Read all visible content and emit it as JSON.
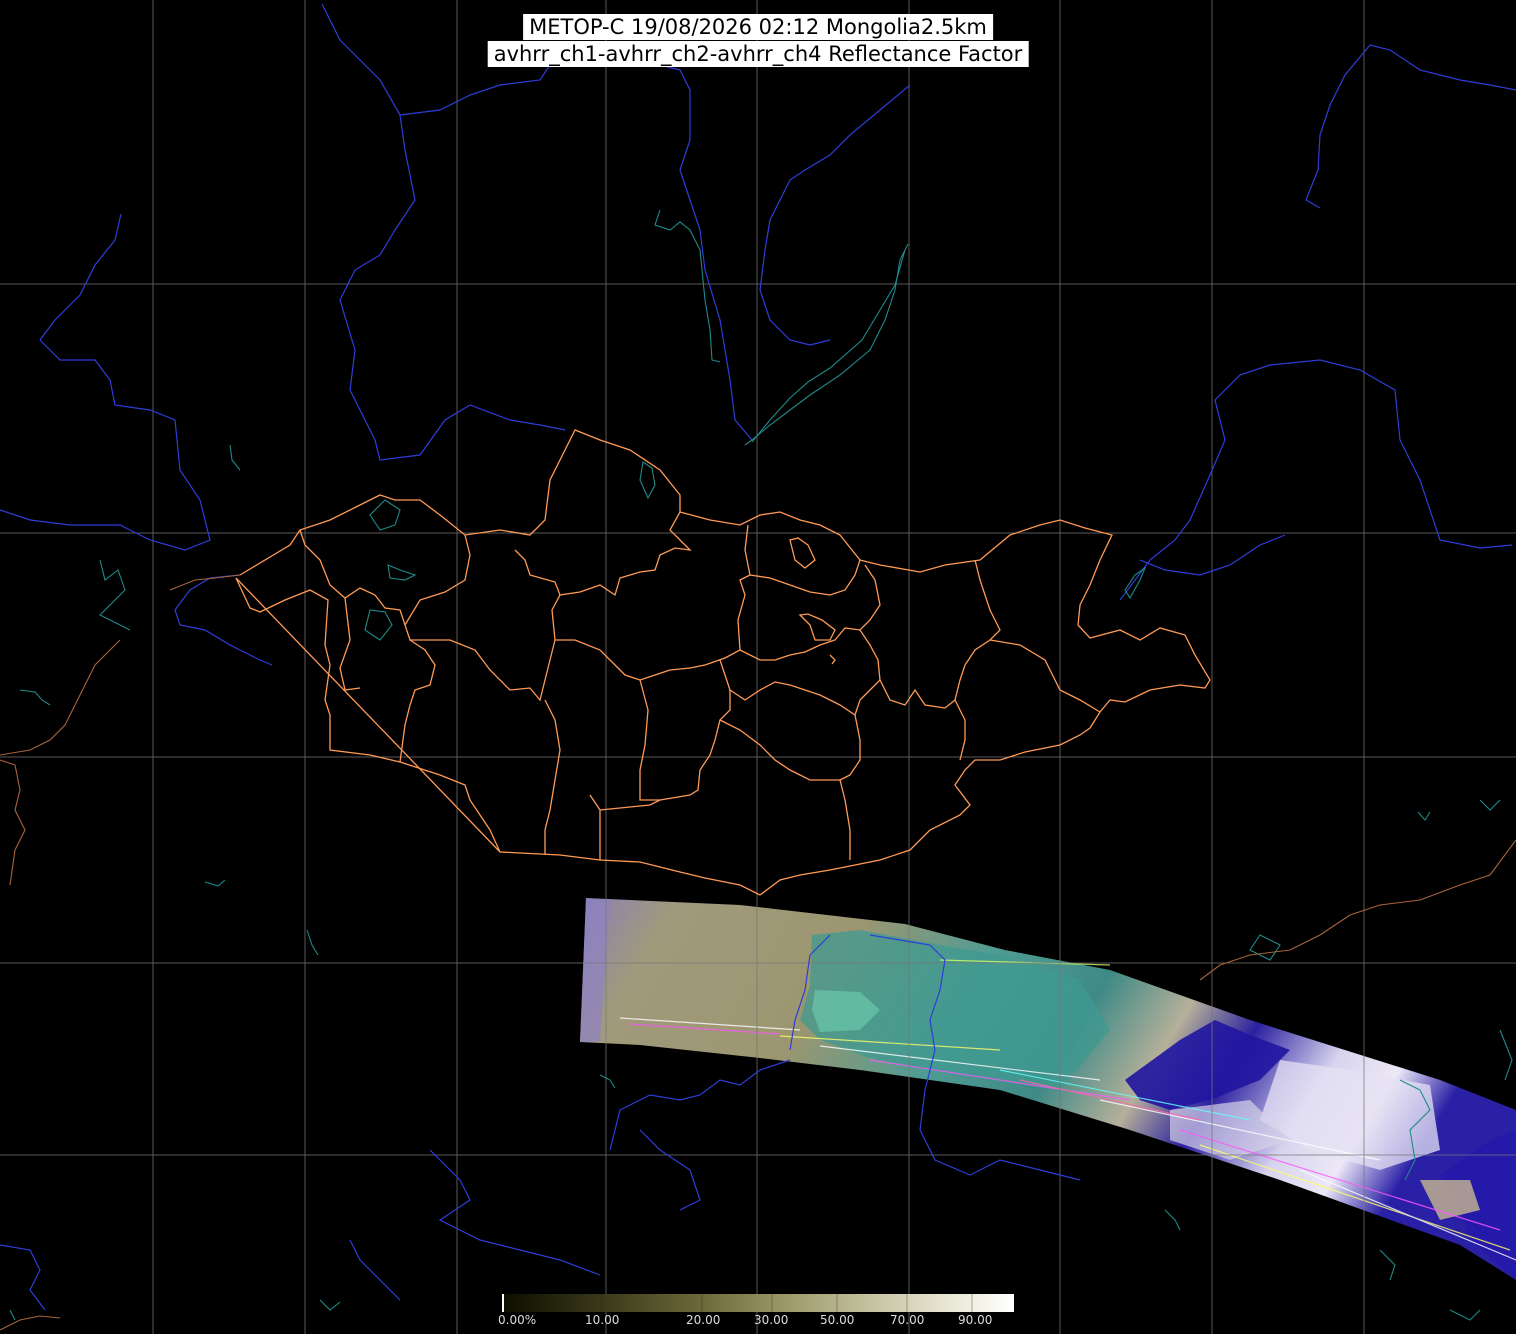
{
  "title": {
    "line1": "METOP-C 19/08/2026 02:12 Mongolia2.5km",
    "line2": "avhrr_ch1-avhrr_ch2-avhrr_ch4 Reflectance Factor"
  },
  "colorbar": {
    "ticks": [
      "0.00%",
      "10.00",
      "20.00",
      "30.00",
      "50.00",
      "70.00",
      "90.00"
    ],
    "gradient_stops": [
      "#0d0d00",
      "#3b3a1a",
      "#6e6c3c",
      "#9b9866",
      "#c4c2a0",
      "#e6e4d0",
      "#ffffff"
    ]
  },
  "colors": {
    "background": "#000000",
    "graticule": "#777777",
    "rivers": "#2f3dd8",
    "coastline": "#1f8a8a",
    "admin_borders": "#ff9a55",
    "foreign_borders": "#a8643a"
  }
}
